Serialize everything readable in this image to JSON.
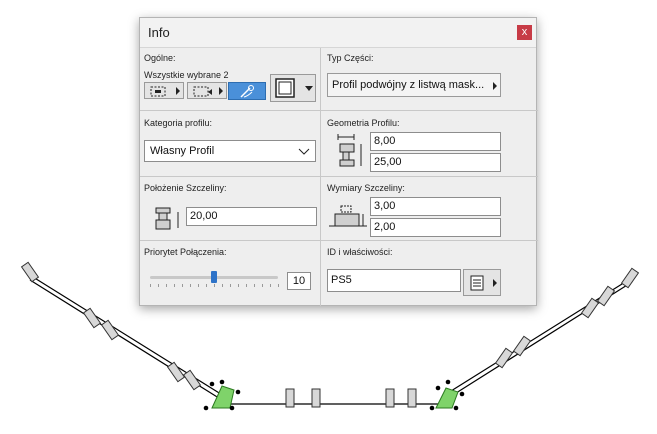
{
  "dialog": {
    "title": "Info",
    "close_glyph": "x"
  },
  "general": {
    "label": "Ogólne:",
    "selection_label": "Wszystkie wybrane 2"
  },
  "part_type": {
    "label": "Typ Części:",
    "value": "Profil podwójny z listwą mask..."
  },
  "profile_category": {
    "label": "Kategoria profilu:",
    "value": "Własny Profil"
  },
  "profile_geometry": {
    "label": "Geometria Profilu:",
    "width": "8,00",
    "height": "25,00"
  },
  "slot_position": {
    "label": "Położenie Szczeliny:",
    "value": "20,00"
  },
  "slot_dimensions": {
    "label": "Wymiary Szczeliny:",
    "width": "3,00",
    "depth": "2,00"
  },
  "connection_priority": {
    "label": "Priorytet Połączenia:",
    "value": "10",
    "slider_fraction": 0.5
  },
  "id_properties": {
    "label": "ID i właściwości:",
    "value": "PS5"
  },
  "colors": {
    "selection_green": "#5fbf3f",
    "accent_blue": "#4a90d9",
    "close_red": "#c73b46"
  }
}
